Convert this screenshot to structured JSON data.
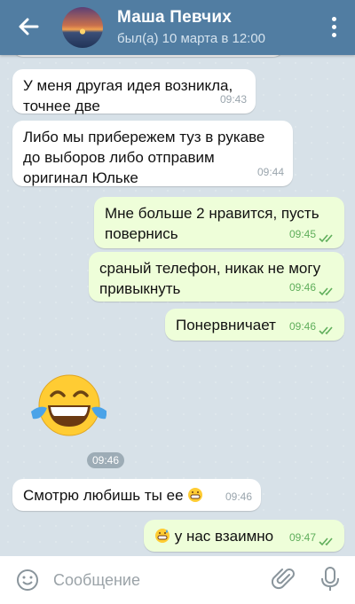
{
  "header": {
    "title": "Маша Певчих",
    "status": "был(а) 10 марта в 12:00"
  },
  "messages": [
    {
      "dir": "in",
      "text": "У меня другая идея возникла, точнее две",
      "time": "09:43"
    },
    {
      "dir": "in",
      "text": "Либо мы прибережем туз в рукаве до выборов либо отправим оригинал Юльке",
      "time": "09:44"
    },
    {
      "dir": "out",
      "text": "Мне больше 2 нравится,  пусть повернись",
      "time": "09:45"
    },
    {
      "dir": "out",
      "text": "сраный телефон, никак не могу привыкнуть",
      "time": "09:46"
    },
    {
      "dir": "out",
      "text": "Понервничает",
      "time": "09:46"
    },
    {
      "dir": "in",
      "type": "sticker",
      "emoji": "tears-of-joy-emoji",
      "time": "09:46"
    },
    {
      "dir": "in",
      "text": "Смотрю любишь ты ее",
      "emoji": "grinning-emoji",
      "time": "09:46"
    },
    {
      "dir": "out",
      "text": "у нас взаимно",
      "emoji": "grinning-sweat-emoji",
      "time": "09:47"
    }
  ],
  "input": {
    "placeholder": "Сообщение"
  },
  "colors": {
    "header": "#517da2",
    "incoming": "#ffffff",
    "outgoing": "#eefed9",
    "check": "#5fae5b"
  }
}
